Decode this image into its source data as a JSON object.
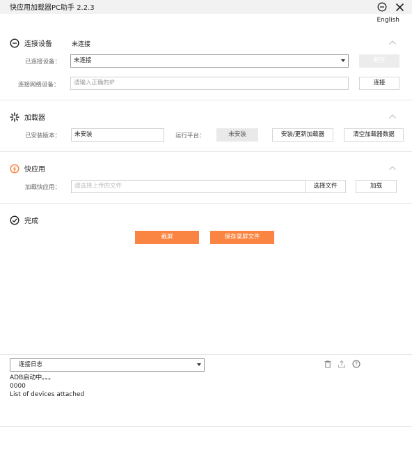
{
  "window": {
    "title": "快应用加载器PC助手 2.2.3"
  },
  "language_link": "English",
  "connect": {
    "title": "连接设备",
    "status": "未连接",
    "device_label": "已连接设备：",
    "device_value": "未连接",
    "disconnect_label": "断开",
    "network_label": "连接网络设备：",
    "ip_placeholder": "请输入正确的IP",
    "connect_label": "连接"
  },
  "loader": {
    "title": "加载器",
    "version_label": "已安装版本：",
    "version_value": "未安装",
    "platform_label": "运行平台：",
    "platform_value": "未安装",
    "install_label": "安装/更新加载器",
    "clear_label": "清空加载器数据"
  },
  "quickapp": {
    "title": "快应用",
    "load_label": "加载快应用：",
    "file_placeholder": "请选择上传的文件",
    "choose_label": "选择文件",
    "load_button": "加载"
  },
  "done": {
    "title": "完成",
    "screenshot_label": "截屏",
    "save_recording_label": "保存录屏文件"
  },
  "log": {
    "selected": "连接日志",
    "lines": [
      "ADB启动中。。。",
      "0000",
      "List of devices attached"
    ]
  },
  "colors": {
    "accent": "#fa8441",
    "titlebar": "#f2f2f2"
  },
  "icons": [
    "minimize-icon",
    "close-icon",
    "connect-icon",
    "loader-icon",
    "quickapp-icon",
    "done-icon",
    "chevron-up-icon",
    "trash-icon",
    "upload-icon",
    "help-icon"
  ]
}
